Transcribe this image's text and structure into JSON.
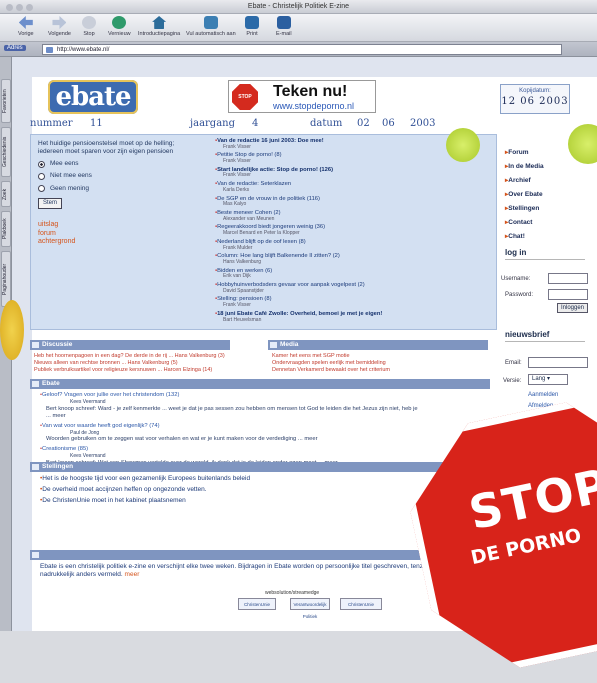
{
  "window": {
    "title": "Ebate - Christelijk Politiek E-zine"
  },
  "toolbar": {
    "items": [
      {
        "label": "Vorige",
        "icon": "back-arrow-icon"
      },
      {
        "label": "Volgende",
        "icon": "forward-arrow-icon"
      },
      {
        "label": "Stop",
        "icon": "stop-icon"
      },
      {
        "label": "Vernieuw",
        "icon": "refresh-icon"
      },
      {
        "label": "Introductiepagina",
        "icon": "home-icon"
      },
      {
        "label": "Vul automatisch aan",
        "icon": "autofill-icon"
      },
      {
        "label": "Print",
        "icon": "print-icon"
      },
      {
        "label": "E-mail",
        "icon": "email-icon"
      }
    ]
  },
  "address": {
    "label": "Adres",
    "url": "http://www.ebate.nl/"
  },
  "sidetabs": [
    "Favorieten",
    "Geschiedenis",
    "Zoek",
    "Plakboek",
    "Paginahouder"
  ],
  "header": {
    "logo": "ebate",
    "banner_title": "Teken nu!",
    "banner_url": "www.stopdeporno.nl",
    "banner_stop": "STOP",
    "date_label": "Kopijdatum:",
    "date_value": "12 06 2003"
  },
  "issue": {
    "nummer_label": "nummer",
    "nummer": "11",
    "jaargang_label": "jaargang",
    "jaargang": "4",
    "datum_label": "datum",
    "day": "02",
    "month": "06",
    "year": "2003"
  },
  "poll": {
    "question": "Het huidige pensioenstelsel moet op de helling; iedereen moet sparen voor zijn eigen pensioen",
    "options": [
      "Mee eens",
      "Niet mee eens",
      "Geen mening"
    ],
    "button": "Stem",
    "links": [
      "uitslag",
      "forum",
      "achtergrond"
    ]
  },
  "news": [
    {
      "title": "Van de redactie 16 juni 2003: Doe mee!",
      "author": "Frank Visser",
      "bold": true
    },
    {
      "title": "Petitie Stop de porno! (8)",
      "author": "Frank Visser"
    },
    {
      "title": "Start landelijke actie: Stop de porno! (126)",
      "author": "Frank Visser",
      "bold": true
    },
    {
      "title": "Van de redactie: Seterklazen",
      "author": "Karla Derks"
    },
    {
      "title": "De SGP en de vrouw in de politiek (116)",
      "author": "Mas Kalyo"
    },
    {
      "title": "Beste meneer Cohen (2)",
      "author": "Alexander van Meunen"
    },
    {
      "title": "Regeerakkoord biedt jongeren weinig (36)",
      "author": "Marcel Benard en Peter la Klopper"
    },
    {
      "title": "Nederland blijft op de oof lexen (8)",
      "author": "Frank Mulder"
    },
    {
      "title": "Column: Hoe lang blijft Balkenende II zitten? (2)",
      "author": "Hans Valkenburg"
    },
    {
      "title": "Bidden en werken (6)",
      "author": "Erik van Dijk"
    },
    {
      "title": "Hobbyhuinverbodsders gevaar voor aanpak vogelpest (2)",
      "author": "David Spaanstjder"
    },
    {
      "title": "Stelling: pensioen (8)",
      "author": "Frank Visser"
    },
    {
      "title": "18 juni Ebate Café Zwolle: Overheid, bemoei je met je eigen!",
      "author": "Bart Heuvelsman",
      "bold": true
    }
  ],
  "rightnav": [
    "Forum",
    "In de Media",
    "Archief",
    "Over Ebate",
    "Stellingen",
    "Contact",
    "Chat!"
  ],
  "login": {
    "heading": "log in",
    "user_label": "Username:",
    "pass_label": "Password:",
    "button": "Inloggen"
  },
  "newsletter": {
    "heading": "nieuwsbrief",
    "email_label": "Email:",
    "version_label": "Versie:",
    "version_value": "Lang",
    "options": [
      "Aanmelden",
      "Afmelden"
    ]
  },
  "sections": {
    "discussie": "Discussie",
    "media": "Media",
    "stellingen": "Stellingen",
    "ebate": "Ebate"
  },
  "leftlinks": [
    "Heb het hoornenpagoen in een dag? De derde in de rij ... Hans Valkenburg (3)",
    "Nieuws alleen van rechtse bronnen ... Hans Valkenburg (5)",
    "Publiek verbruiksartikel voor religieuze kersnuwen ... Harcen Elzinga (14)"
  ],
  "medialinks": [
    "Kamer het eens met SGP motie",
    "Ondervraagden spelen eerlijk met bemiddeling",
    "Dennetan Verkamerd bewaakt over het criterium"
  ],
  "forum": [
    {
      "q": "Geloof? Vragen voor jullie over het christendom (132)",
      "by": "Kees Veermand",
      "a": "Bert knoop schreef: Ward - je zelf kenmerkte ... weet je dat je pas sessen zou hebben om mensen tot God te leiden die het Jezus zijn niet, heb je ... meer"
    },
    {
      "q": "Van wat voor waarde heeft god eigenlijk? (74)",
      "by": "Paul de Jong",
      "a": "Woorden gebruiken om te zeggen wat voor verhalen en wat er je kunt maken voor de verdediging ... meer"
    },
    {
      "q": "Creationisme (85)",
      "by": "Kees Veermand",
      "a": "Bert knoop schreef: Wat een Showmen vertelde over de wereld, ik denk dat je de leiden onder ogen moet ... meer"
    }
  ],
  "stellingen": [
    "Het is de hoogste tijd voor een gezamenlijk Europees buitenlands beleid",
    "De overheid moet accijnzen heffen op ongezonde vetten.",
    "De ChristenUnie moet in het kabinet plaatsnemen"
  ],
  "about": "Ebate is een christelijk politiek e-zine en verschijnt elke twee weken. Bijdragen in Ebate worden op persoonlijke titel geschreven, tenzij nadrukkelijk anders vermeld.",
  "about_more": "meer",
  "footer": {
    "credit": "websolution/streamedge",
    "logos": [
      "ChristenUnie",
      "Verantwoordelijk Politiek",
      "ChristenUnie"
    ]
  },
  "stop": {
    "line1": "STOP",
    "line2": "DE PORNO"
  },
  "colors": {
    "panel": "#d3e0f2",
    "accent": "#d4541c",
    "stop_red": "#d8231a",
    "logo_blue": "#3d6bb0"
  }
}
